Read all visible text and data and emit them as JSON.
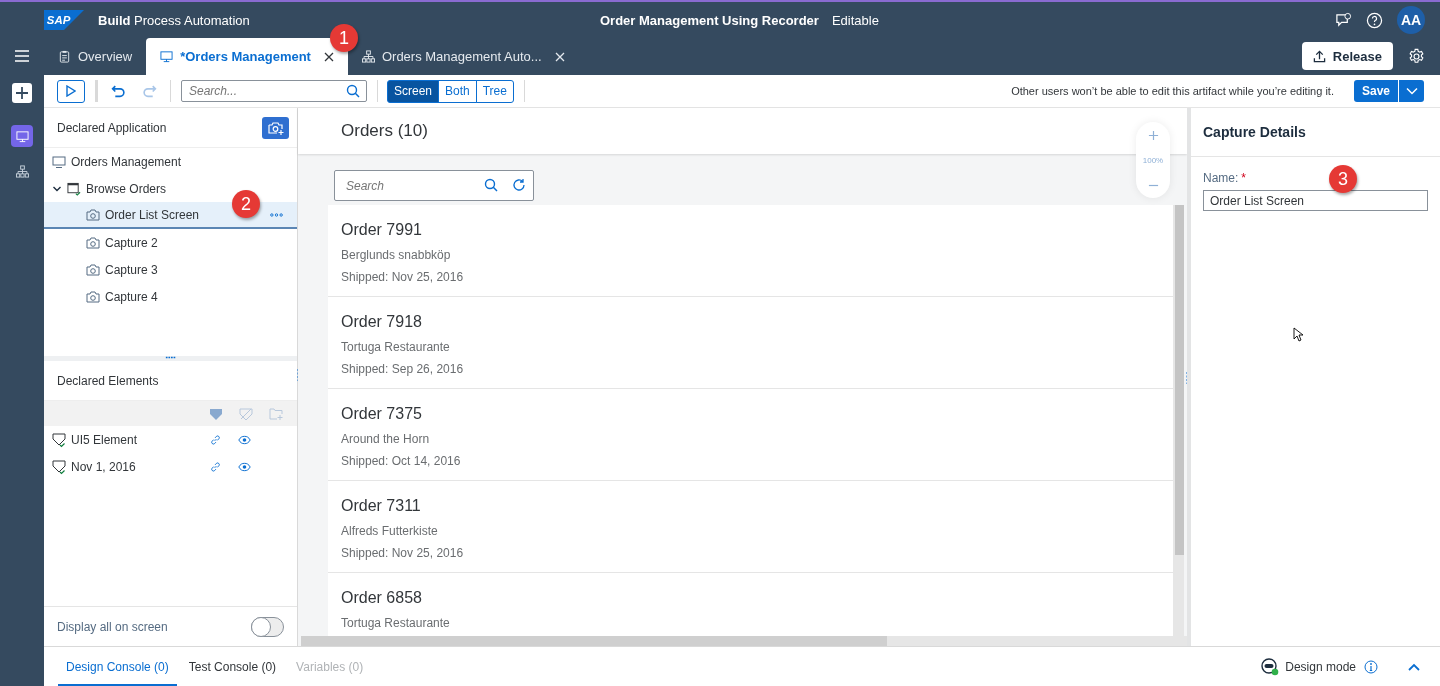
{
  "header": {
    "logo": "SAP",
    "product_bold": "Build",
    "product_rest": "Process Automation",
    "title": "Order Management Using Recorder",
    "status": "Editable",
    "avatar": "AA"
  },
  "tabs": [
    {
      "label": "Overview",
      "kind": "overview",
      "selected": false,
      "closable": false
    },
    {
      "label": "*Orders Management",
      "kind": "screen",
      "selected": true,
      "closable": true,
      "callout": "1"
    },
    {
      "label": "Orders Management Auto...",
      "kind": "process",
      "selected": false,
      "closable": true
    }
  ],
  "release_button": "Release",
  "rail": [
    {
      "kind": "screen",
      "selected": true
    },
    {
      "kind": "process",
      "selected": false
    }
  ],
  "toolbar": {
    "search_placeholder": "Search...",
    "views": [
      {
        "label": "Screen",
        "selected": true
      },
      {
        "label": "Both",
        "selected": false
      },
      {
        "label": "Tree",
        "selected": false
      }
    ],
    "notice": "Other users won’t be able to edit this artifact while you’re editing it.",
    "save": "Save"
  },
  "declared_application": {
    "title": "Declared Application",
    "tree": [
      {
        "label": "Orders Management",
        "kind": "application",
        "selected": false
      },
      {
        "label": "Browse Orders",
        "kind": "screen",
        "selected": false,
        "expanded": true,
        "children": [
          {
            "label": "Order List Screen",
            "kind": "capture",
            "selected": true,
            "callout": "2"
          },
          {
            "label": "Capture 2",
            "kind": "capture",
            "selected": false
          },
          {
            "label": "Capture 3",
            "kind": "capture",
            "selected": false
          },
          {
            "label": "Capture 4",
            "kind": "capture",
            "selected": false
          }
        ]
      }
    ]
  },
  "declared_elements": {
    "title": "Declared Elements",
    "rows": [
      {
        "label": "UI5 Element"
      },
      {
        "label": "Nov 1, 2016"
      }
    ]
  },
  "display_all": {
    "label": "Display all on screen",
    "on": false
  },
  "orders": {
    "title": "Orders (10)",
    "search_placeholder": "Search",
    "zoom": "100%",
    "items": [
      {
        "title": "Order 7991",
        "customer": "Berglunds snabbköp",
        "shipped": "Shipped: Nov 25, 2016"
      },
      {
        "title": "Order 7918",
        "customer": "Tortuga Restaurante",
        "shipped": "Shipped: Sep 26, 2016"
      },
      {
        "title": "Order 7375",
        "customer": "Around the Horn",
        "shipped": "Shipped: Oct 14, 2016"
      },
      {
        "title": "Order 7311",
        "customer": "Alfreds Futterkiste",
        "shipped": "Shipped: Nov 25, 2016"
      },
      {
        "title": "Order 6858",
        "customer": "Tortuga Restaurante"
      }
    ]
  },
  "capture_details": {
    "title": "Capture Details",
    "name_label": "Name:",
    "required_mark": "*",
    "name_value": "Order List Screen",
    "callout": "3"
  },
  "console_tabs": [
    {
      "label": "Design Console (0)",
      "selected": true,
      "disabled": false
    },
    {
      "label": "Test Console (0)",
      "selected": false,
      "disabled": false
    },
    {
      "label": "Variables (0)",
      "selected": false,
      "disabled": true
    }
  ],
  "design_mode": "Design mode"
}
